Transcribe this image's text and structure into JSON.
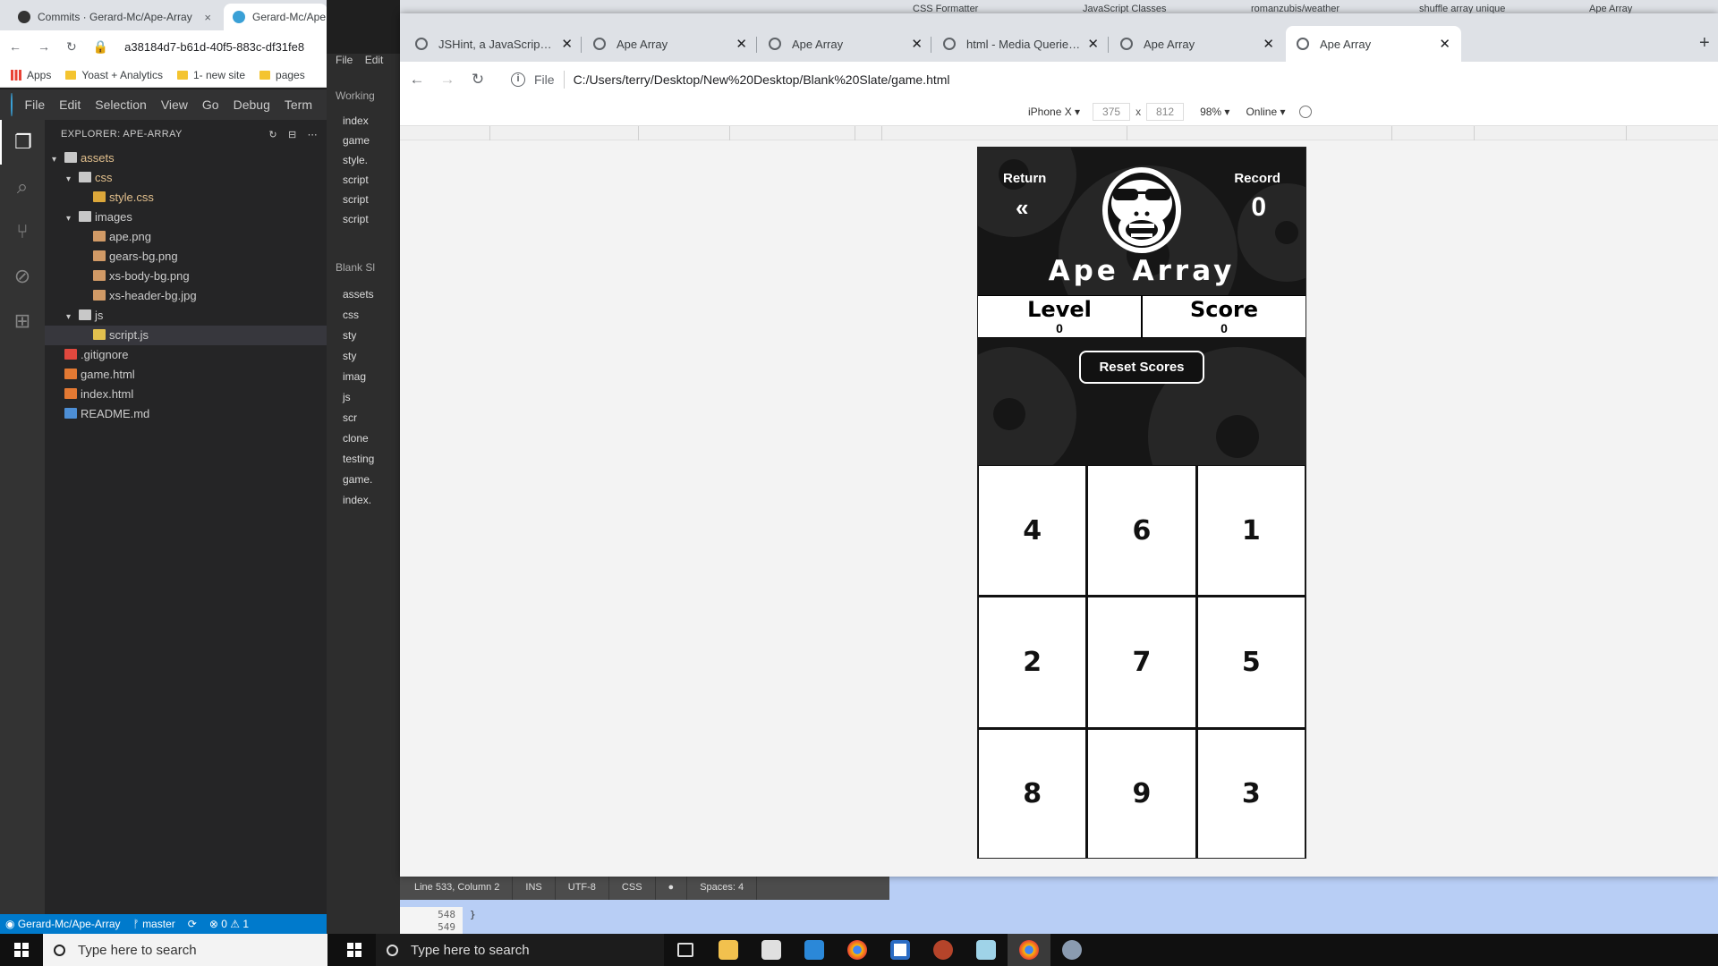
{
  "back_browser": {
    "tabs": [
      {
        "title": "Commits · Gerard-Mc/Ape-Array",
        "close": "×"
      },
      {
        "title": "Gerard-Mc/Ape",
        "close": ""
      }
    ],
    "url": "a38184d7-b61d-40f5-883c-df31fe8",
    "bookmarks": [
      "Apps",
      "Yoast + Analytics",
      "1- new site",
      "pages"
    ],
    "far_tabs": [
      "CSS Formatter",
      "JavaScript Classes",
      "romanzubis/weather",
      "shuffle array unique",
      "Ape Array"
    ]
  },
  "vscode": {
    "menu": [
      "File",
      "Edit",
      "Selection",
      "View",
      "Go",
      "Debug",
      "Term"
    ],
    "explorer_title": "EXPLORER: APE-ARRAY",
    "tree": [
      {
        "label": "assets",
        "indent": 0,
        "kind": "folder",
        "twist": "v",
        "modified": true
      },
      {
        "label": "css",
        "indent": 1,
        "kind": "folder",
        "twist": "v",
        "modified": true
      },
      {
        "label": "style.css",
        "indent": 2,
        "kind": "css",
        "twist": "",
        "modified": true
      },
      {
        "label": "images",
        "indent": 1,
        "kind": "folder",
        "twist": "v",
        "modified": false
      },
      {
        "label": "ape.png",
        "indent": 2,
        "kind": "img",
        "twist": "",
        "modified": false
      },
      {
        "label": "gears-bg.png",
        "indent": 2,
        "kind": "img",
        "twist": "",
        "modified": false
      },
      {
        "label": "xs-body-bg.png",
        "indent": 2,
        "kind": "img",
        "twist": "",
        "modified": false
      },
      {
        "label": "xs-header-bg.jpg",
        "indent": 2,
        "kind": "img",
        "twist": "",
        "modified": false
      },
      {
        "label": "js",
        "indent": 1,
        "kind": "folder",
        "twist": "v",
        "modified": false
      },
      {
        "label": "script.js",
        "indent": 2,
        "kind": "js",
        "twist": "",
        "modified": false,
        "selected": true
      },
      {
        "label": ".gitignore",
        "indent": 0,
        "kind": "git",
        "twist": "",
        "modified": false
      },
      {
        "label": "game.html",
        "indent": 0,
        "kind": "html",
        "twist": "",
        "modified": false
      },
      {
        "label": "index.html",
        "indent": 0,
        "kind": "html",
        "twist": "",
        "modified": false
      },
      {
        "label": "README.md",
        "indent": 0,
        "kind": "md",
        "twist": "",
        "modified": false
      }
    ],
    "status": {
      "repo": "Gerard-Mc/Ape-Array",
      "branch": "master",
      "errors": "0",
      "warnings": "1"
    }
  },
  "brackets": {
    "menu": [
      "File",
      "Edit"
    ],
    "working_label": "Working",
    "working_files": [
      "index",
      "game",
      "style.",
      "script",
      "script",
      "script"
    ],
    "project_label": "Blank Sl",
    "project_tree": [
      "assets",
      "css",
      "sty",
      "sty",
      "imag",
      "js",
      "scr",
      "clone",
      "testing",
      "game.",
      "index."
    ],
    "status": {
      "position": "Line 533, Column 2",
      "mode": "INS",
      "encoding": "UTF-8",
      "language": "CSS",
      "spaces": "Spaces: 4"
    },
    "gutter": [
      "548",
      "549"
    ],
    "code_line": "}"
  },
  "front_browser": {
    "tabs": [
      {
        "title": "JSHint, a JavaScript Code Quality",
        "active": false
      },
      {
        "title": "Ape Array",
        "active": false
      },
      {
        "title": "Ape Array",
        "active": false
      },
      {
        "title": "html - Media Queries: check min",
        "active": false
      },
      {
        "title": "Ape Array",
        "active": false
      },
      {
        "title": "Ape Array",
        "active": true
      }
    ],
    "new_tab": "+",
    "file_label": "File",
    "url": "C:/Users/terry/Desktop/New%20Desktop/Blank%20Slate/game.html",
    "device_toolbar": {
      "device": "iPhone X ▾",
      "width": "375",
      "height": "812",
      "times": "x",
      "zoom": "98% ▾",
      "network": "Online ▾"
    }
  },
  "game": {
    "title": "Ape Array",
    "return_label": "Return",
    "return_symbol": "«",
    "record_label": "Record",
    "record_value": "0",
    "level_label": "Level",
    "level_value": "0",
    "score_label": "Score",
    "score_value": "0",
    "reset_label": "Reset Scores",
    "tiles": [
      "4",
      "6",
      "1",
      "2",
      "7",
      "5",
      "8",
      "9",
      "3"
    ]
  },
  "taskbar": {
    "search_placeholder": "Type here to search",
    "search_placeholder_2": "Type here to search"
  },
  "colors": {
    "game_dark": "#161616",
    "vscode_status": "#007acc",
    "chrome_tabbar": "#dee1e6"
  }
}
